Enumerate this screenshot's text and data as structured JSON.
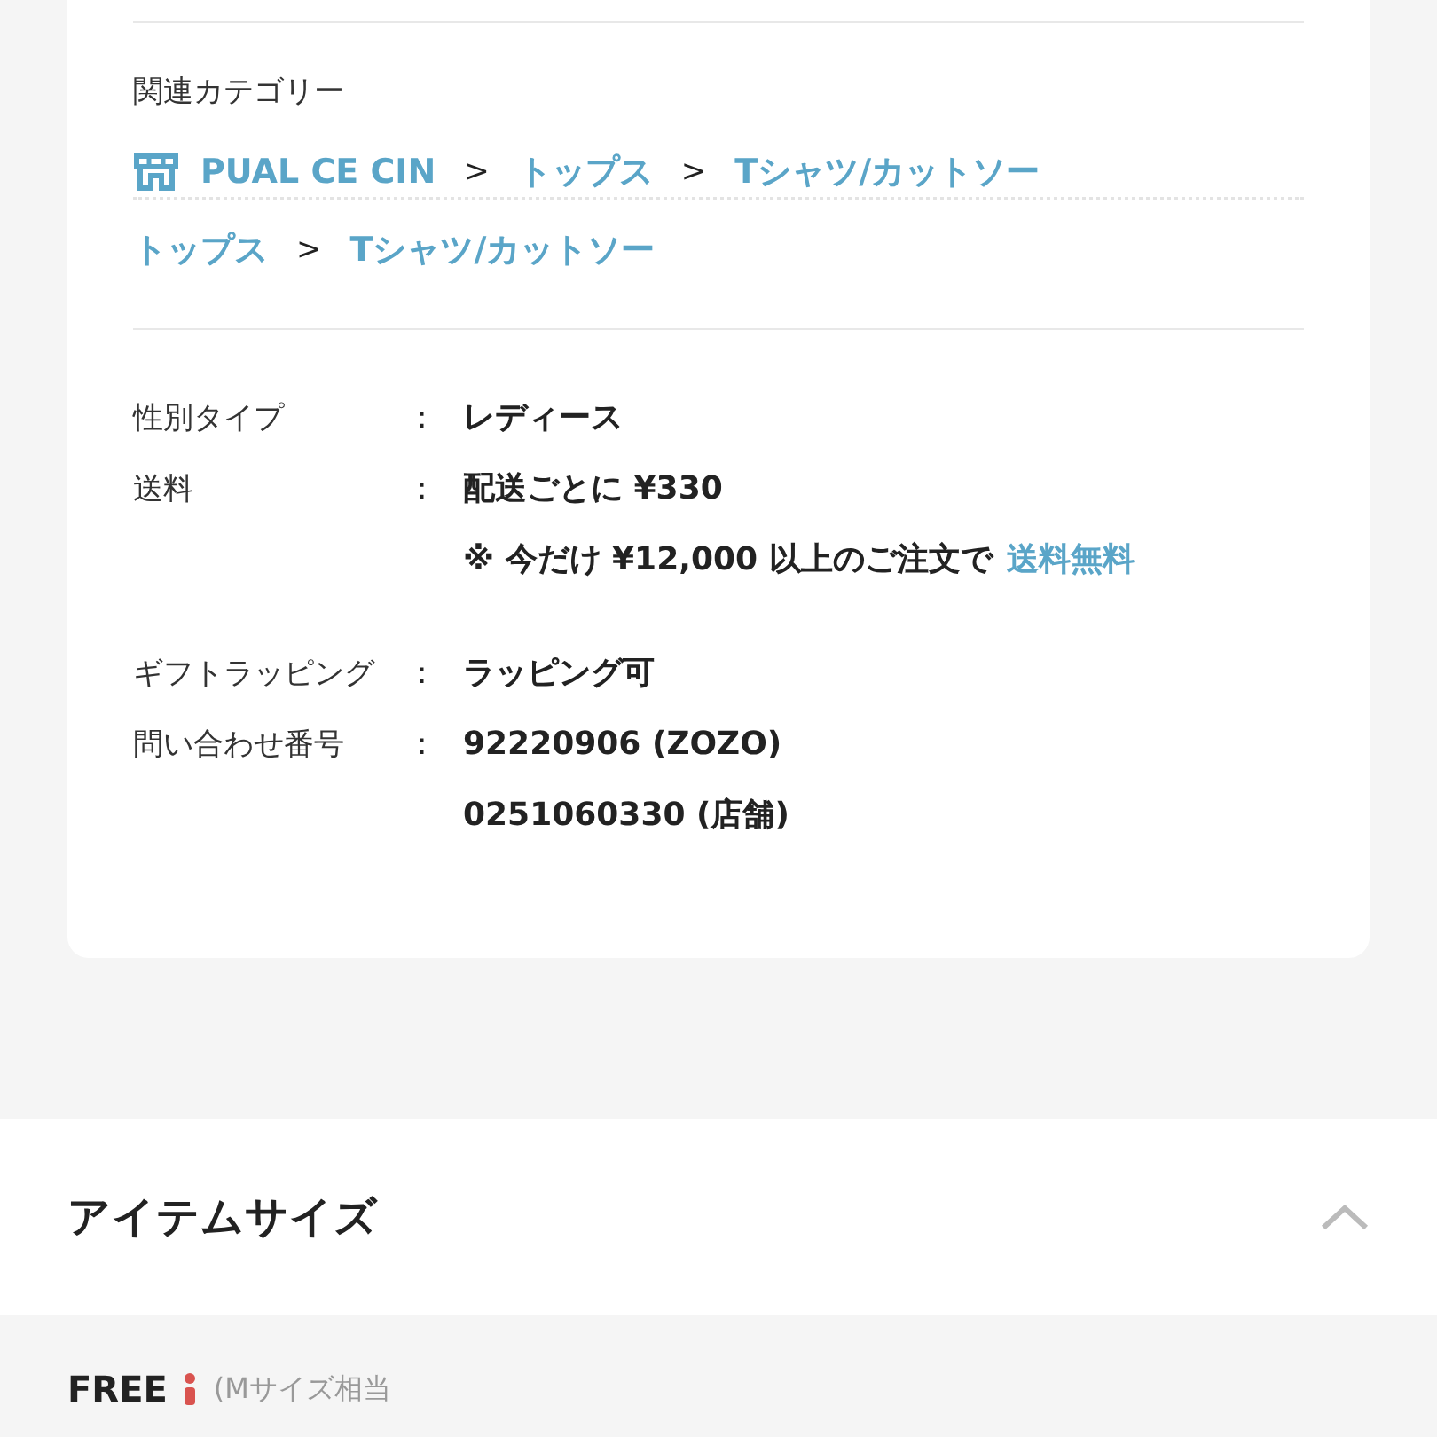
{
  "related": {
    "heading": "関連カテゴリー",
    "paths": [
      {
        "kind": "shop",
        "items": [
          "PUAL CE CIN",
          "トップス",
          "Tシャツ/カットソー"
        ]
      },
      {
        "kind": "category",
        "items": [
          "トップス",
          "Tシャツ/カットソー"
        ]
      }
    ],
    "separator": ">"
  },
  "detail_groups": [
    [
      {
        "label": "性別タイプ",
        "lines": [
          {
            "text": "レディース"
          }
        ]
      },
      {
        "label": "送料",
        "lines": [
          {
            "text": "配送ごとに ¥330"
          },
          {
            "text": "※ 今だけ ¥12,000 以上のご注文で",
            "link": "送料無料"
          }
        ]
      }
    ],
    [
      {
        "label": "ギフトラッピング",
        "lines": [
          {
            "text": "ラッピング可"
          }
        ]
      },
      {
        "label": "問い合わせ番号",
        "lines": [
          {
            "text": "92220906 (ZOZO)"
          },
          {
            "text": "0251060330 (店舗)"
          }
        ]
      }
    ]
  ],
  "colon": ":",
  "size_section": {
    "title": "アイテムサイズ",
    "expanded": true
  },
  "sizes": [
    {
      "name": "FREE",
      "note": "(Mサイズ相当"
    }
  ]
}
